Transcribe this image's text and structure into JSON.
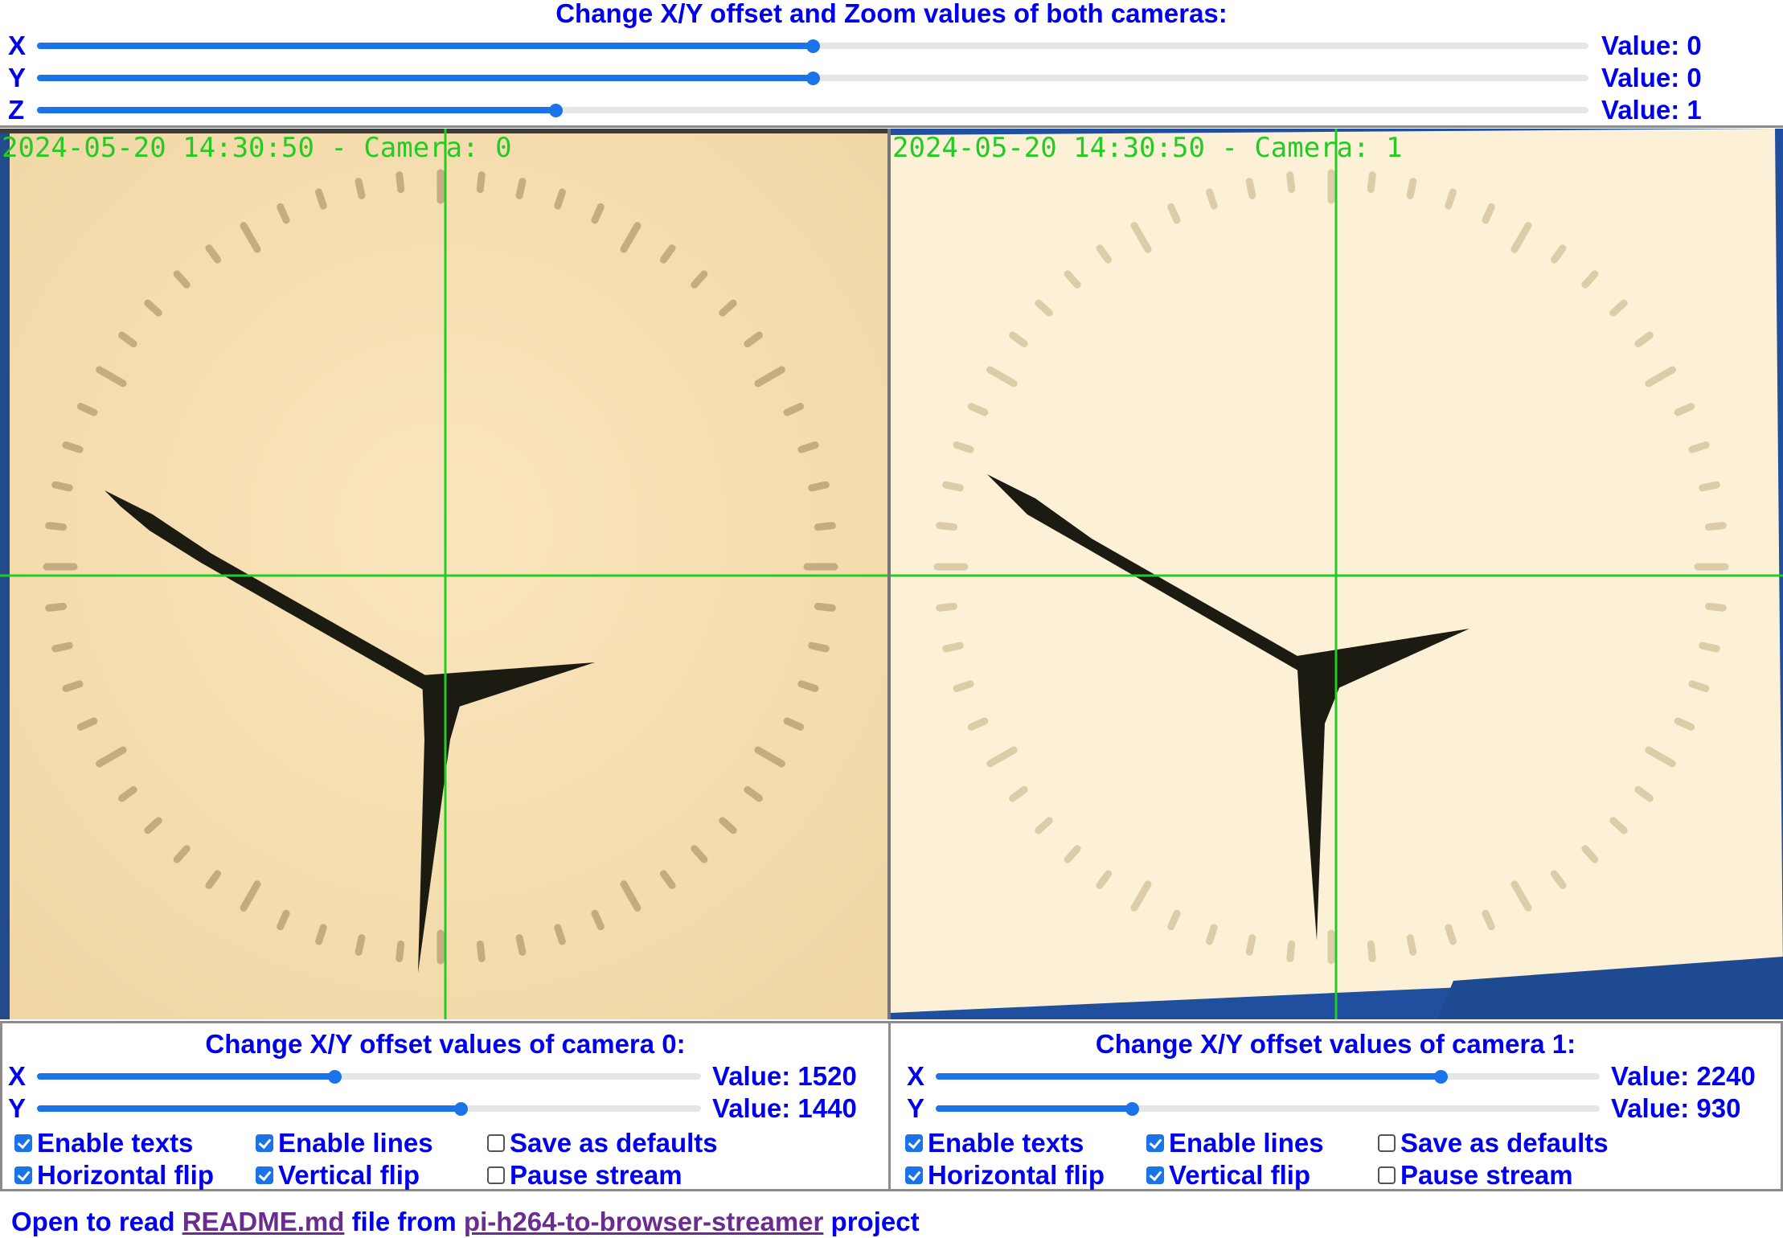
{
  "global_controls": {
    "title": "Change X/Y offset and Zoom values of both cameras:",
    "sliders": [
      {
        "axis": "X",
        "value_label": "Value: 0",
        "fraction": 0.5
      },
      {
        "axis": "Y",
        "value_label": "Value: 0",
        "fraction": 0.5
      },
      {
        "axis": "Z",
        "value_label": "Value: 1",
        "fraction": 0.334
      }
    ]
  },
  "cameras": [
    {
      "overlay_text": "2024-05-20 14:30:50 - Camera: 0",
      "title": "Change X/Y offset values of camera 0:",
      "sliders": [
        {
          "axis": "X",
          "value_label": "Value: 1520",
          "fraction": 0.448
        },
        {
          "axis": "Y",
          "value_label": "Value: 1440",
          "fraction": 0.638
        }
      ],
      "checkboxes": [
        {
          "label": "Enable texts",
          "checked": true
        },
        {
          "label": "Enable lines",
          "checked": true
        },
        {
          "label": "Save as defaults",
          "checked": false
        },
        {
          "label": "Horizontal flip",
          "checked": true
        },
        {
          "label": "Vertical flip",
          "checked": true
        },
        {
          "label": "Pause stream",
          "checked": false
        }
      ]
    },
    {
      "overlay_text": "2024-05-20 14:30:50 - Camera: 1",
      "title": "Change X/Y offset values of camera 1:",
      "sliders": [
        {
          "axis": "X",
          "value_label": "Value: 2240",
          "fraction": 0.76
        },
        {
          "axis": "Y",
          "value_label": "Value: 930",
          "fraction": 0.296
        }
      ],
      "checkboxes": [
        {
          "label": "Enable texts",
          "checked": true
        },
        {
          "label": "Enable lines",
          "checked": true
        },
        {
          "label": "Save as defaults",
          "checked": false
        },
        {
          "label": "Horizontal flip",
          "checked": true
        },
        {
          "label": "Vertical flip",
          "checked": true
        },
        {
          "label": "Pause stream",
          "checked": false
        }
      ]
    }
  ],
  "footer": {
    "prefix": "Open to read",
    "readme_link": "README.md",
    "middle": "file from",
    "project_link": "pi-h264-to-browser-streamer",
    "suffix": "project"
  },
  "colors": {
    "accent": "#1a73e8",
    "text": "#0000ee",
    "link_visited": "#6b2c8f",
    "overlay_green": "#22cc22"
  }
}
